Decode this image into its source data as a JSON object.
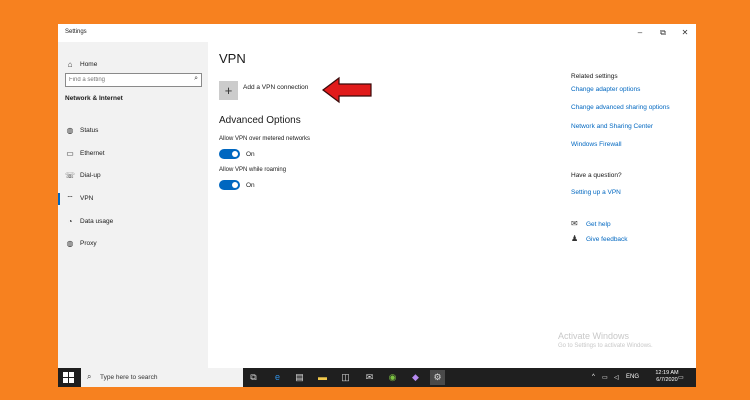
{
  "window": {
    "title": "Settings",
    "controls": {
      "minimize": "–",
      "maximize": "⧉",
      "close": "✕"
    }
  },
  "sidebar": {
    "home_label": "Home",
    "search_placeholder": "Find a setting",
    "section_title": "Network & Internet",
    "items": [
      {
        "label": "Status",
        "icon": "globe-icon"
      },
      {
        "label": "Ethernet",
        "icon": "ethernet-icon"
      },
      {
        "label": "Dial-up",
        "icon": "phone-icon"
      },
      {
        "label": "VPN",
        "icon": "vpn-icon"
      },
      {
        "label": "Data usage",
        "icon": "data-usage-icon"
      },
      {
        "label": "Proxy",
        "icon": "globe-icon"
      }
    ],
    "active_item": "VPN"
  },
  "main": {
    "title": "VPN",
    "add_vpn_label": "Add a VPN connection",
    "advanced_title": "Advanced Options",
    "options": [
      {
        "label": "Allow VPN over metered networks",
        "state": "On"
      },
      {
        "label": "Allow VPN while roaming",
        "state": "On"
      }
    ]
  },
  "related": {
    "heading": "Related settings",
    "links": [
      "Change adapter options",
      "Change advanced sharing options",
      "Network and Sharing Center",
      "Windows Firewall"
    ],
    "question_heading": "Have a question?",
    "question_link": "Setting up a VPN",
    "get_help": "Get help",
    "give_feedback": "Give feedback"
  },
  "watermark": {
    "line1": "Activate Windows",
    "line2": "Go to Settings to activate Windows."
  },
  "taskbar": {
    "search_placeholder": "Type here to search",
    "language": "ENG",
    "time": "12:19 AM",
    "date": "6/7/2020"
  },
  "colors": {
    "background": "#f7811f",
    "accent": "#0067c0",
    "arrow": "#e11b1b"
  }
}
